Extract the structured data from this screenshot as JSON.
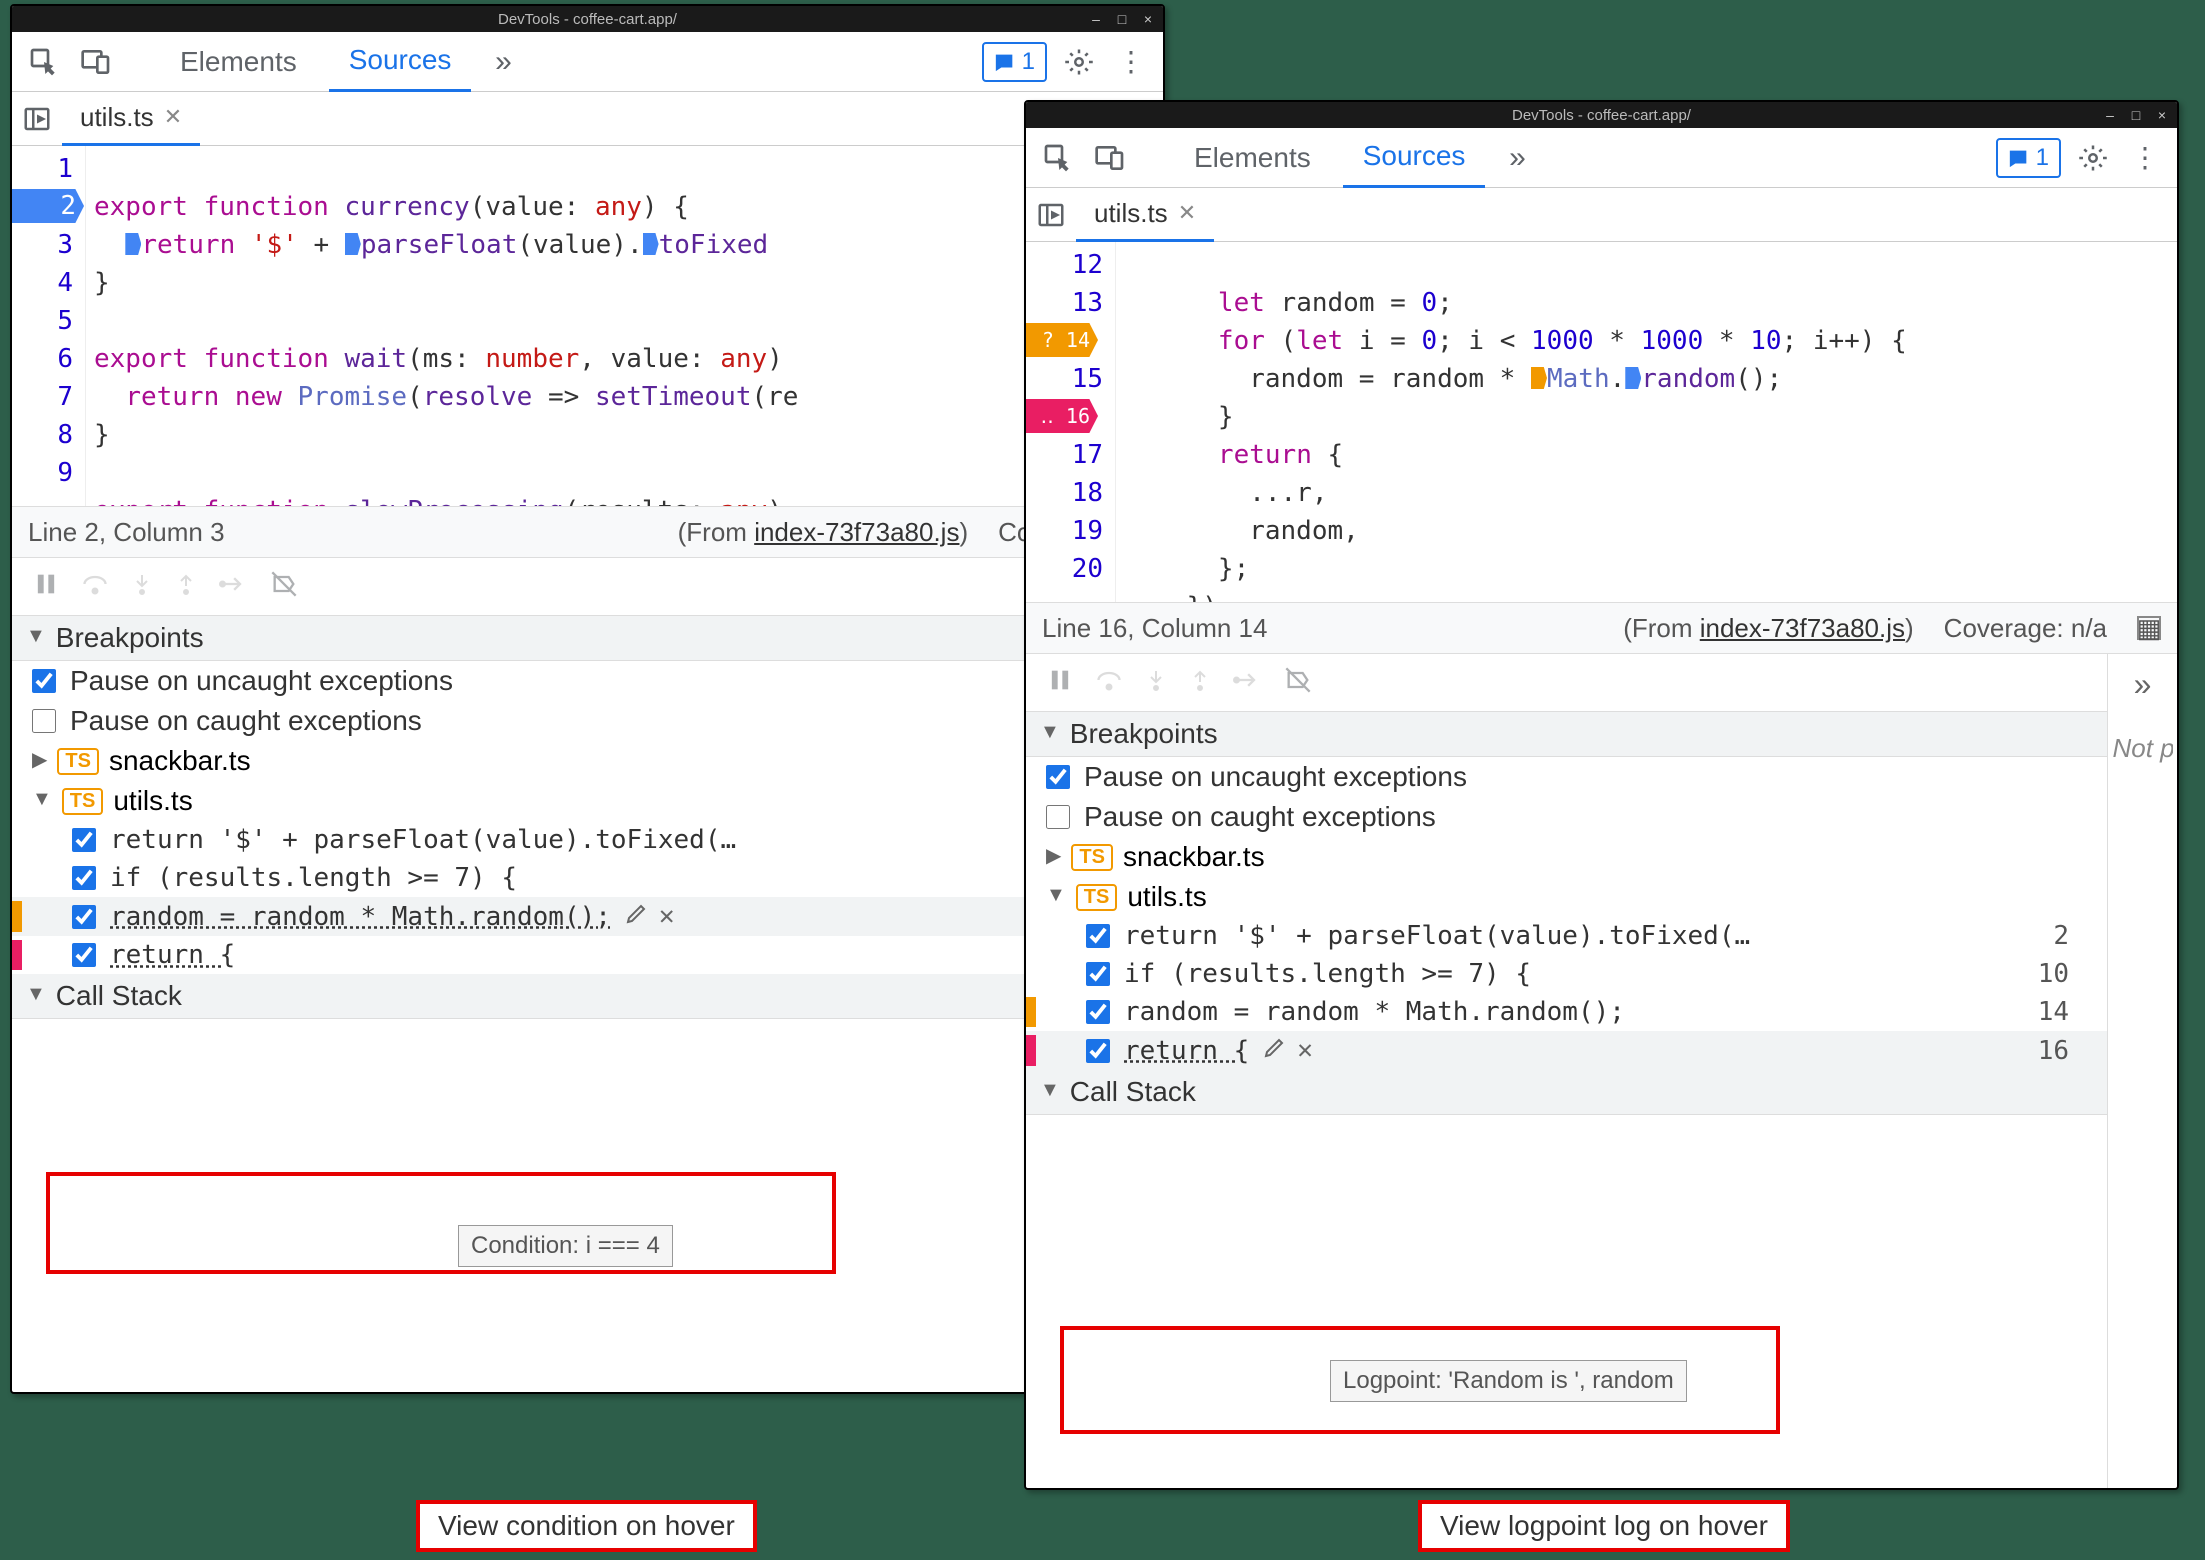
{
  "window_title": "DevTools - coffee-cart.app/",
  "tabs": {
    "elements": "Elements",
    "sources": "Sources"
  },
  "issues_count": "1",
  "file_tab": "utils.ts",
  "w1_code": {
    "lines": [
      "1",
      "2",
      "3",
      "4",
      "5",
      "6",
      "7",
      "8",
      "9"
    ],
    "l1a": "export ",
    "l1b": "function ",
    "l1c": "currency",
    "l1d": "(value: ",
    "l1e": "any",
    "l1f": ") {",
    "l2a": "  ",
    "l2b": "return ",
    "l2c": "'$'",
    "l2d": " + ",
    "l2e": "parseFloat",
    "l2f": "(value).",
    "l2g": "toFixed",
    "l3": "}",
    "l4": "",
    "l5a": "export ",
    "l5b": "function ",
    "l5c": "wait",
    "l5d": "(ms: ",
    "l5e": "number",
    "l5f": ", value: ",
    "l5g": "any",
    "l5h": ")",
    "l6a": "  ",
    "l6b": "return ",
    "l6c": "new ",
    "l6d": "Promise",
    "l6e": "(",
    "l6f": "resolve",
    "l6g": " => ",
    "l6h": "setTimeout",
    "l6i": "(re",
    "l7": "}",
    "l8": "",
    "l9a": "export ",
    "l9b": "function ",
    "l9c": "slowProcessing",
    "l9d": "(results: ",
    "l9e": "any",
    "l9f": ")"
  },
  "w2_code": {
    "lines": [
      "12",
      "13",
      "14",
      "15",
      "16",
      "17",
      "18",
      "19",
      "20"
    ],
    "l12a": "      ",
    "l12b": "let ",
    "l12c": "random = ",
    "l12d": "0",
    "l12e": ";",
    "l13a": "      ",
    "l13b": "for ",
    "l13c": "(",
    "l13d": "let ",
    "l13e": "i = ",
    "l13f": "0",
    "l13g": "; i < ",
    "l13h": "1000",
    "l13i": " * ",
    "l13j": "1000",
    "l13k": " * ",
    "l13l": "10",
    "l13m": "; i++) {",
    "l14a": "        random = random * ",
    "l14b": "Math",
    "l14c": ".",
    "l14d": "random",
    "l14e": "();",
    "l15": "      }",
    "l16a": "      ",
    "l16b": "return ",
    "l16c": "{",
    "l17": "        ...r,",
    "l18": "        random,",
    "l19": "      };",
    "l20": "    })"
  },
  "status1": {
    "pos": "Line 2, Column 3",
    "from_prefix": "(From ",
    "from": "index-73f73a80.js",
    "coverage": "Coverage: n/"
  },
  "status2": {
    "pos": "Line 16, Column 14",
    "from_prefix": "(From ",
    "from": "index-73f73a80.js",
    "coverage": "Coverage: n/a"
  },
  "sections": {
    "breakpoints": "Breakpoints",
    "callstack": "Call Stack"
  },
  "exc": {
    "uncaught": "Pause on uncaught exceptions",
    "caught": "Pause on caught exceptions"
  },
  "files": {
    "snackbar": "snackbar.ts",
    "utils": "utils.ts"
  },
  "bps": {
    "r1": {
      "code": "return '$' + parseFloat(value).toFixed(…",
      "ln": "2"
    },
    "r2": {
      "code": "if (results.length >= 7) {",
      "ln": "10"
    },
    "r3": {
      "code": "random = random * Math.random();",
      "ln": "14"
    },
    "r4": {
      "code": "return {",
      "ln": "16"
    }
  },
  "tooltip1": "Condition: i === 4",
  "tooltip2": "Logpoint: 'Random is ', random",
  "caption1": "View condition on hover",
  "caption2": "View logpoint log on hover",
  "notpaused": "Not pa",
  "chevron": "»"
}
